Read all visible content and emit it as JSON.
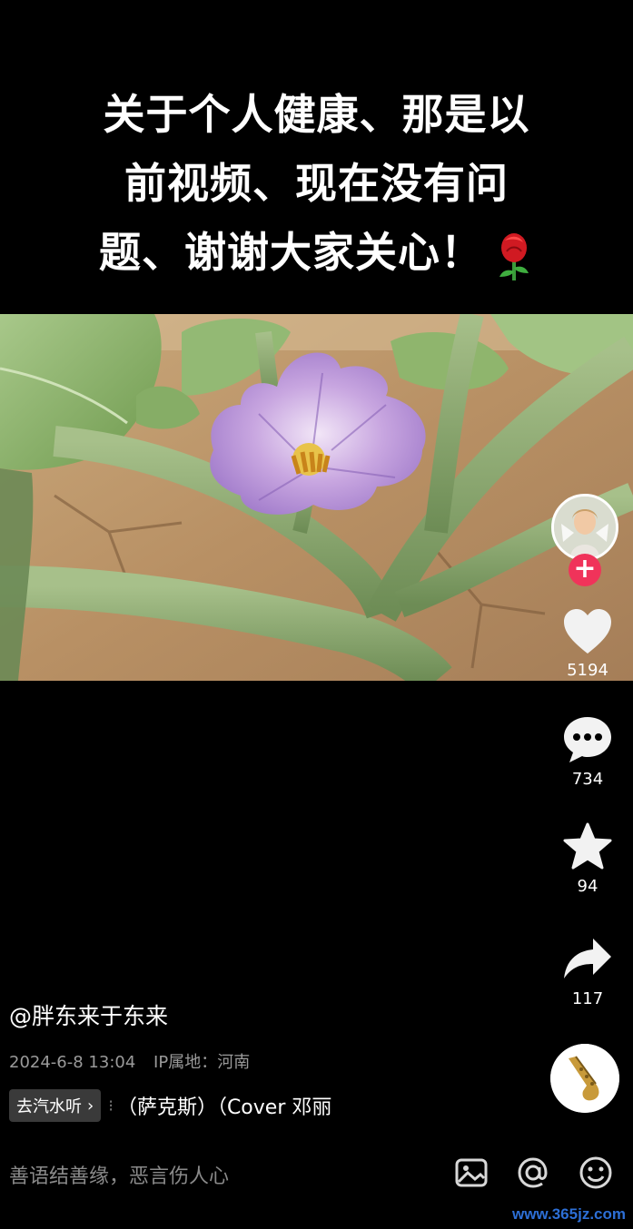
{
  "caption": {
    "lines": [
      "关于个人健康、那是以",
      "前视频、现在没有问",
      "题、谢谢大家关心！"
    ]
  },
  "actions": {
    "likes": "5194",
    "comments": "734",
    "favorites": "94",
    "shares": "117"
  },
  "info": {
    "author": "@胖东来于东来",
    "date": "2024-6-8 13:04",
    "ip": "IP属地：河南",
    "listen_button": "去汽水听",
    "music_title": "（萨克斯）（Cover 邓丽"
  },
  "bottom": {
    "comment_placeholder": "善语结善缘，恶言伤人心"
  },
  "watermark": "www.365jz.com",
  "icons": [
    "rose-icon",
    "heart-icon",
    "comment-icon",
    "star-icon",
    "share-icon",
    "image-icon",
    "at-icon",
    "emoji-icon",
    "plus-icon",
    "chevron-right-icon"
  ],
  "colors": {
    "follow": "#f0335a",
    "watermark": "#2d6fd6"
  }
}
